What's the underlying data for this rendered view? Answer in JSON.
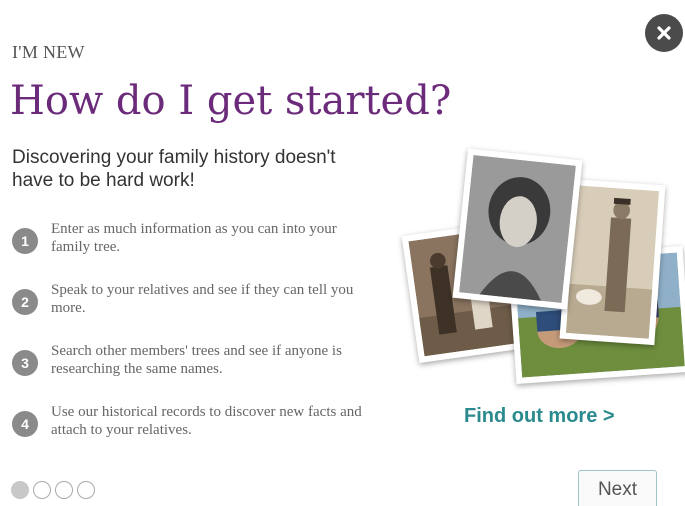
{
  "close": {
    "icon": "close-icon"
  },
  "header": {
    "eyebrow": "I'M NEW",
    "title": "How do I get started?",
    "subtitle": "Discovering your family history doesn't have to be hard work!"
  },
  "steps": [
    {
      "number": "1",
      "text": "Enter as much information as you can into your family tree."
    },
    {
      "number": "2",
      "text": "Speak to your relatives and see if they can tell you more."
    },
    {
      "number": "3",
      "text": "Search other members' trees and see if anyone is researching the same names."
    },
    {
      "number": "4",
      "text": "Use our historical records to discover new facts and attach to your relatives."
    }
  ],
  "cta": {
    "find_more": "Find out more >"
  },
  "pagination": {
    "total": 4,
    "active": 1
  },
  "nav": {
    "next_label": "Next"
  },
  "colors": {
    "title": "#6b2a7a",
    "link": "#2a8a8e",
    "close_bg": "#4b4b4b"
  }
}
